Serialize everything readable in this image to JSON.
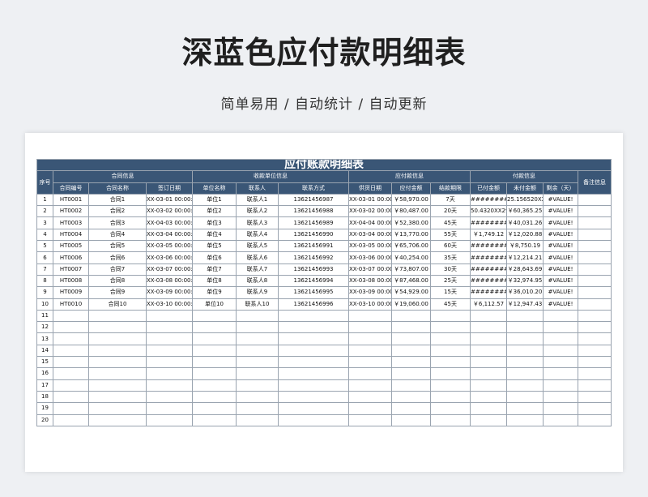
{
  "header": {
    "title": "深蓝色应付款明细表",
    "subtitle": "简单易用 / 自动统计 / 自动更新"
  },
  "table": {
    "banner": "应付账款明细表",
    "groups": {
      "seq": "序号",
      "contract": "合同信息",
      "supplier": "收款单位信息",
      "payable": "应付款信息",
      "paid": "付款信息",
      "remark": "备注信息"
    },
    "columns": [
      "合同编号",
      "合同名称",
      "签订日期",
      "单位名称",
      "联系人",
      "联系方式",
      "供货日期",
      "应付金额",
      "结款期限",
      "已付金额",
      "未付金额",
      "剩余（天）"
    ],
    "rows": [
      {
        "no": "1",
        "code": "HT0001",
        "name": "合同1",
        "sign": "XX-03-01 00:00:0",
        "unit": "单位1",
        "contact": "联系人1",
        "phone": "13621456987",
        "supply": "XX-03-01 00:00:",
        "payable": "￥58,970.00",
        "term": "7天",
        "paid": "#########",
        "unpaid": "25.156520XX5",
        "remain": "#VALUE!"
      },
      {
        "no": "2",
        "code": "HT0002",
        "name": "合同2",
        "sign": "XX-03-02 00:00:0",
        "unit": "单位2",
        "contact": "联系人2",
        "phone": "13621456988",
        "supply": "XX-03-02 00:00:",
        "payable": "￥80,487.00",
        "term": "20天",
        "paid": "50.4320XX29",
        "unpaid": "￥60,365.25",
        "remain": "#VALUE!"
      },
      {
        "no": "3",
        "code": "HT0003",
        "name": "合同3",
        "sign": "XX-04-03 00:00:0",
        "unit": "单位3",
        "contact": "联系人3",
        "phone": "13621456989",
        "supply": "XX-04-04 00:00:",
        "payable": "￥52,380.00",
        "term": "45天",
        "paid": "#########",
        "unpaid": "￥40,031.26",
        "remain": "#VALUE!"
      },
      {
        "no": "4",
        "code": "HT0004",
        "name": "合同4",
        "sign": "XX-03-04 00:00:0",
        "unit": "单位4",
        "contact": "联系人4",
        "phone": "13621456990",
        "supply": "XX-03-04 00:00:",
        "payable": "￥13,770.00",
        "term": "55天",
        "paid": "￥1,749.12",
        "unpaid": "￥12,020.88",
        "remain": "#VALUE!"
      },
      {
        "no": "5",
        "code": "HT0005",
        "name": "合同5",
        "sign": "XX-03-05 00:00:0",
        "unit": "单位5",
        "contact": "联系人5",
        "phone": "13621456991",
        "supply": "XX-03-05 00:00:",
        "payable": "￥65,706.00",
        "term": "60天",
        "paid": "#########",
        "unpaid": "￥8,750.19",
        "remain": "#VALUE!"
      },
      {
        "no": "6",
        "code": "HT0006",
        "name": "合同6",
        "sign": "XX-03-06 00:00:0",
        "unit": "单位6",
        "contact": "联系人6",
        "phone": "13621456992",
        "supply": "XX-03-06 00:00:",
        "payable": "￥40,254.00",
        "term": "35天",
        "paid": "#########",
        "unpaid": "￥12,214.21",
        "remain": "#VALUE!"
      },
      {
        "no": "7",
        "code": "HT0007",
        "name": "合同7",
        "sign": "XX-03-07 00:00:0",
        "unit": "单位7",
        "contact": "联系人7",
        "phone": "13621456993",
        "supply": "XX-03-07 00:00:",
        "payable": "￥73,807.00",
        "term": "30天",
        "paid": "#########",
        "unpaid": "￥28,643.69",
        "remain": "#VALUE!"
      },
      {
        "no": "8",
        "code": "HT0008",
        "name": "合同8",
        "sign": "XX-03-08 00:00:0",
        "unit": "单位8",
        "contact": "联系人8",
        "phone": "13621456994",
        "supply": "XX-03-08 00:00:",
        "payable": "￥87,468.00",
        "term": "25天",
        "paid": "#########",
        "unpaid": "￥32,974.95",
        "remain": "#VALUE!"
      },
      {
        "no": "9",
        "code": "HT0009",
        "name": "合同9",
        "sign": "XX-03-09 00:00:0",
        "unit": "单位9",
        "contact": "联系人9",
        "phone": "13621456995",
        "supply": "XX-03-09 00:00:",
        "payable": "￥54,929.00",
        "term": "15天",
        "paid": "#########",
        "unpaid": "￥36,010.20",
        "remain": "#VALUE!"
      },
      {
        "no": "10",
        "code": "HT0010",
        "name": "合同10",
        "sign": "XX-03-10 00:00:0",
        "unit": "单位10",
        "contact": "联系人10",
        "phone": "13621456996",
        "supply": "XX-03-10 00:00:",
        "payable": "￥19,060.00",
        "term": "45天",
        "paid": "￥6,112.57",
        "unpaid": "￥12,947.43",
        "remain": "#VALUE!"
      }
    ],
    "empty_row_numbers": [
      "11",
      "12",
      "13",
      "14",
      "15",
      "16",
      "17",
      "18",
      "19",
      "20"
    ]
  }
}
